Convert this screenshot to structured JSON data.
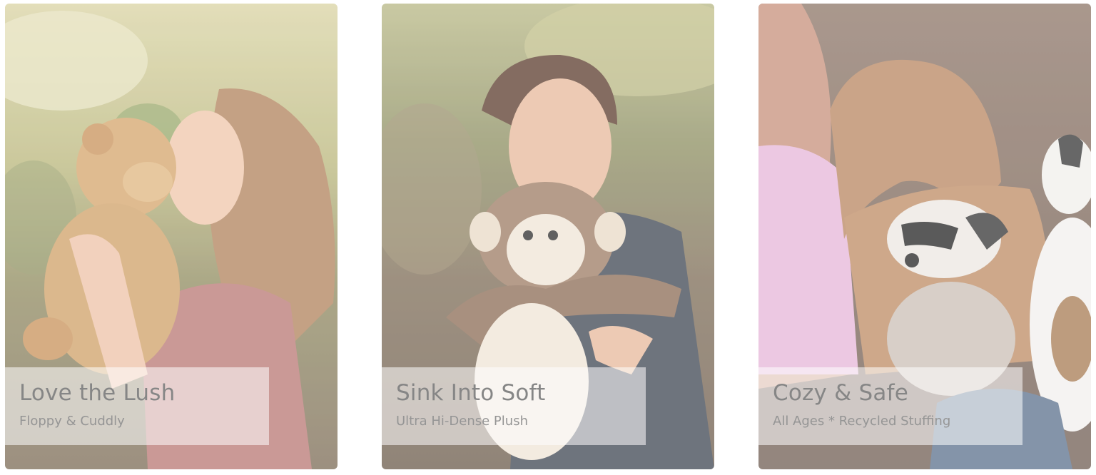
{
  "cards": [
    {
      "title": "Love the Lush",
      "subtitle": "Floppy & Cuddly",
      "image_icon": "girl-kissing-teddy-bear-photo"
    },
    {
      "title": "Sink Into Soft",
      "subtitle": "Ultra Hi-Dense Plush",
      "image_icon": "boy-hugging-monkey-plush-photo"
    },
    {
      "title": "Cozy & Safe",
      "subtitle": "All Ages * Recycled Stuffing",
      "image_icon": "girl-hugging-raccoon-plush-photo"
    }
  ],
  "colors": {
    "caption_text": "#7a7a7a",
    "caption_sub_text": "#8a8a8a",
    "caption_bg": "#ffffff"
  }
}
